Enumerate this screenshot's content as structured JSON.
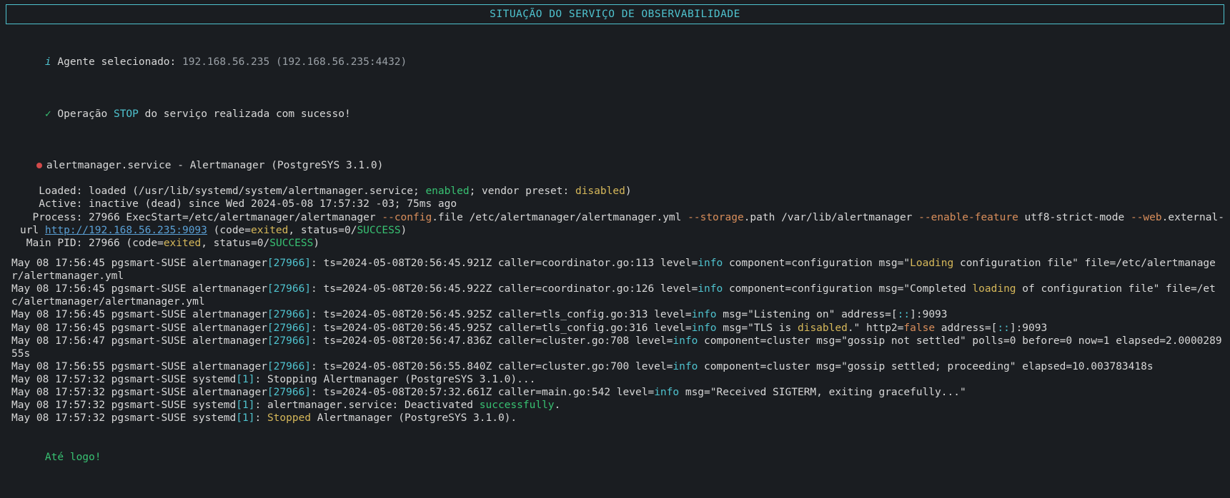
{
  "title": "SITUAÇÃO DO SERVIÇO DE OBSERVABILIDADE",
  "agent": {
    "label": "Agente selecionado: ",
    "value": "192.168.56.235 (192.168.56.235:4432)"
  },
  "operation": {
    "pre": "Operação ",
    "op": "STOP",
    "post": " do serviço realizada com sucesso!"
  },
  "service": {
    "name": "alertmanager.service - Alertmanager (PostgreSYS 3.1.0)",
    "loaded_label": "   Loaded: ",
    "loaded_pre": "loaded (/usr/lib/systemd/system/alertmanager.service; ",
    "enabled": "enabled",
    "loaded_mid": "; vendor preset: ",
    "disabled": "disabled",
    "loaded_end": ")",
    "active_label": "   Active: ",
    "active_value": "inactive (dead) since Wed 2024-05-08 17:57:32 -03; 75ms ago",
    "process_label": "  Process: ",
    "process_pid": "27966 ExecStart=/etc/alertmanager/alertmanager ",
    "flag_config": "--config",
    "process_mid1": ".file /etc/alertmanager/alertmanager.yml ",
    "flag_storage": "--storage",
    "process_mid2": ".path /var/lib/alertmanager ",
    "flag_enable": "--enable-feature",
    "process_mid3": " utf8-strict-mode ",
    "flag_web": "--web",
    "process_mid4": ".external-url ",
    "url": "http://192.168.56.235:9093",
    "process_mid5": " (code=",
    "exited": "exited",
    "process_mid6": ", status=0/",
    "success": "SUCCESS",
    "process_end": ")",
    "mainpid_label": " Main PID: ",
    "mainpid_pre": "27966 (code=",
    "mainpid_mid": ", status=0/",
    "mainpid_end": ")"
  },
  "logs": [
    {
      "ts": "May 08 17:56:45",
      "host": "pgsmart-SUSE",
      "proc": "alertmanager",
      "pid": "27966",
      "tail": "ts=2024-05-08T20:56:45.921Z caller=coordinator.go:113 level=",
      "level": "info",
      "after": " component=configuration msg=\"",
      "hl1": "Loading",
      "after2": " configuration file\" file=/etc/alertmanager/alertmanager.yml"
    },
    {
      "ts": "May 08 17:56:45",
      "host": "pgsmart-SUSE",
      "proc": "alertmanager",
      "pid": "27966",
      "tail": "ts=2024-05-08T20:56:45.922Z caller=coordinator.go:126 level=",
      "level": "info",
      "after": " component=configuration msg=\"Completed ",
      "hl1": "loading",
      "after2": " of configuration file\" file=/etc/alertmanager/alertmanager.yml"
    },
    {
      "ts": "May 08 17:56:45",
      "host": "pgsmart-SUSE",
      "proc": "alertmanager",
      "pid": "27966",
      "tail": "ts=2024-05-08T20:56:45.925Z caller=tls_config.go:313 level=",
      "level": "info",
      "after": " msg=\"Listening on\" address=[",
      "hl1": "::",
      "after2": "]:9093"
    },
    {
      "ts": "May 08 17:56:45",
      "host": "pgsmart-SUSE",
      "proc": "alertmanager",
      "pid": "27966",
      "tail": "ts=2024-05-08T20:56:45.925Z caller=tls_config.go:316 level=",
      "level": "info",
      "after": " msg=\"TLS is ",
      "hl1": "disabled",
      "after2": ".\" http2=",
      "hl2": "false",
      "after3": " address=[",
      "hl3": "::",
      "after4": "]:9093"
    },
    {
      "ts": "May 08 17:56:47",
      "host": "pgsmart-SUSE",
      "proc": "alertmanager",
      "pid": "27966",
      "tail": "ts=2024-05-08T20:56:47.836Z caller=cluster.go:708 level=",
      "level": "info",
      "after": " component=cluster msg=\"gossip not settled\" polls=0 before=0 now=1 elapsed=2.000028955s"
    },
    {
      "ts": "May 08 17:56:55",
      "host": "pgsmart-SUSE",
      "proc": "alertmanager",
      "pid": "27966",
      "tail": "ts=2024-05-08T20:56:55.840Z caller=cluster.go:700 level=",
      "level": "info",
      "after": " component=cluster msg=\"gossip settled; proceeding\" elapsed=10.003783418s"
    },
    {
      "ts": "May 08 17:57:32",
      "host": "pgsmart-SUSE",
      "proc": "systemd",
      "pid": "1",
      "plainmsg": "Stopping Alertmanager (PostgreSYS 3.1.0)..."
    },
    {
      "ts": "May 08 17:57:32",
      "host": "pgsmart-SUSE",
      "proc": "alertmanager",
      "pid": "27966",
      "tail": "ts=2024-05-08T20:57:32.661Z caller=main.go:542 level=",
      "level": "info",
      "after": " msg=\"Received SIGTERM, exiting gracefully...\""
    },
    {
      "ts": "May 08 17:57:32",
      "host": "pgsmart-SUSE",
      "proc": "systemd",
      "pid": "1",
      "plainmsg": "alertmanager.service: Deactivated ",
      "hl1": "successfully",
      "after2": "."
    },
    {
      "ts": "May 08 17:57:32",
      "host": "pgsmart-SUSE",
      "proc": "systemd",
      "pid": "1",
      "plainpre": "",
      "hl0": "Stopped",
      "plainmsg": " Alertmanager (PostgreSYS 3.1.0)."
    }
  ],
  "bye": "Até logo!"
}
